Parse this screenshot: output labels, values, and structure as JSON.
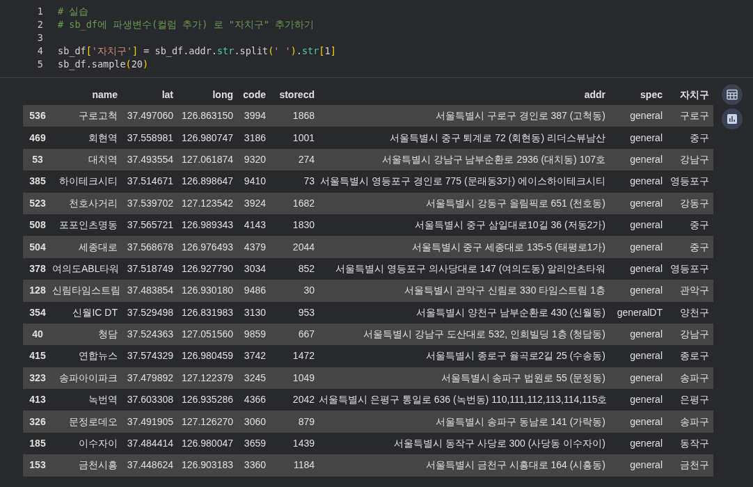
{
  "code": {
    "lines": [
      {
        "number": "1",
        "tokens": [
          {
            "text": "# 실습",
            "kind": "comment"
          }
        ]
      },
      {
        "number": "2",
        "tokens": [
          {
            "text": "# sb_df에 파생변수(컬럼 추가) 로 \"자치구\" 추가하기",
            "kind": "comment"
          }
        ]
      },
      {
        "number": "3"
      },
      {
        "number": "4",
        "tokens": [
          {
            "text": "sb_df",
            "kind": "plain"
          },
          {
            "text": "[",
            "kind": "bracket"
          },
          {
            "text": "'자치구'",
            "kind": "string"
          },
          {
            "text": "]",
            "kind": "bracket"
          },
          {
            "text": " = sb_df.addr.",
            "kind": "plain"
          },
          {
            "text": "str",
            "kind": "builtin"
          },
          {
            "text": ".split",
            "kind": "plain"
          },
          {
            "text": "(",
            "kind": "bracket"
          },
          {
            "text": "' '",
            "kind": "string"
          },
          {
            "text": ")",
            "kind": "bracket"
          },
          {
            "text": ".",
            "kind": "plain"
          },
          {
            "text": "str",
            "kind": "builtin"
          },
          {
            "text": "[",
            "kind": "bracket"
          },
          {
            "text": "1",
            "kind": "plain"
          },
          {
            "text": "]",
            "kind": "bracket"
          }
        ]
      },
      {
        "number": "5",
        "tokens": [
          {
            "text": "sb_df.sample",
            "kind": "plain"
          },
          {
            "text": "(",
            "kind": "bracket"
          },
          {
            "text": "20",
            "kind": "plain"
          },
          {
            "text": ")",
            "kind": "bracket"
          }
        ]
      }
    ]
  },
  "table": {
    "columns": [
      "name",
      "lat",
      "long",
      "code",
      "storecd",
      "addr",
      "spec",
      "자치구"
    ],
    "rows": [
      {
        "index": "536",
        "cells": [
          "구로고척",
          "37.497060",
          "126.863150",
          "3994",
          "1868",
          "서울특별시 구로구 경인로 387 (고척동)",
          "general",
          "구로구"
        ]
      },
      {
        "index": "469",
        "cells": [
          "회현역",
          "37.558981",
          "126.980747",
          "3186",
          "1001",
          "서울특별시 중구 퇴계로 72 (회현동) 리더스뷰남산",
          "general",
          "중구"
        ]
      },
      {
        "index": "53",
        "cells": [
          "대치역",
          "37.493554",
          "127.061874",
          "9320",
          "274",
          "서울특별시 강남구 남부순환로 2936 (대치동) 107호",
          "general",
          "강남구"
        ]
      },
      {
        "index": "385",
        "cells": [
          "하이테크시티",
          "37.514671",
          "126.898647",
          "9410",
          "73",
          "서울특별시 영등포구 경인로 775 (문래동3가) 에이스하이테크시티",
          "general",
          "영등포구"
        ]
      },
      {
        "index": "523",
        "cells": [
          "천호사거리",
          "37.539702",
          "127.123542",
          "3924",
          "1682",
          "서울특별시 강동구 올림픽로 651 (천호동)",
          "general",
          "강동구"
        ]
      },
      {
        "index": "508",
        "cells": [
          "포포인츠명동",
          "37.565721",
          "126.989343",
          "4143",
          "1830",
          "서울특별시 중구 삼일대로10길 36 (저동2가)",
          "general",
          "중구"
        ]
      },
      {
        "index": "504",
        "cells": [
          "세종대로",
          "37.568678",
          "126.976493",
          "4379",
          "2044",
          "서울특별시 중구 세종대로 135-5 (태평로1가)",
          "general",
          "중구"
        ]
      },
      {
        "index": "378",
        "cells": [
          "여의도ABL타워",
          "37.518749",
          "126.927790",
          "3034",
          "852",
          "서울특별시 영등포구 의사당대로 147 (여의도동) 알리안츠타워",
          "general",
          "영등포구"
        ]
      },
      {
        "index": "128",
        "cells": [
          "신림타임스트림",
          "37.483854",
          "126.930180",
          "9486",
          "30",
          "서울특별시 관악구 신림로 330 타임스트림 1층",
          "general",
          "관악구"
        ]
      },
      {
        "index": "354",
        "cells": [
          "신월IC DT",
          "37.529498",
          "126.831983",
          "3130",
          "953",
          "서울특별시 양천구 남부순환로 430 (신월동)",
          "generalDT",
          "양천구"
        ]
      },
      {
        "index": "40",
        "cells": [
          "청담",
          "37.524363",
          "127.051560",
          "9859",
          "667",
          "서울특별시 강남구 도산대로 532, 인희빌딩 1층 (청담동)",
          "general",
          "강남구"
        ]
      },
      {
        "index": "415",
        "cells": [
          "연합뉴스",
          "37.574329",
          "126.980459",
          "3742",
          "1472",
          "서울특별시 종로구 율곡로2길 25 (수송동)",
          "general",
          "종로구"
        ]
      },
      {
        "index": "323",
        "cells": [
          "송파아이파크",
          "37.479892",
          "127.122379",
          "3245",
          "1049",
          "서울특별시 송파구 법원로 55 (문정동)",
          "general",
          "송파구"
        ]
      },
      {
        "index": "413",
        "cells": [
          "녹번역",
          "37.603308",
          "126.935286",
          "4366",
          "2042",
          "서울특별시 은평구 통일로 636 (녹번동) 110,111,112,113,114,115호",
          "general",
          "은평구"
        ]
      },
      {
        "index": "326",
        "cells": [
          "문정로데오",
          "37.491905",
          "127.126270",
          "3060",
          "879",
          "서울특별시 송파구 동남로 141 (가락동)",
          "general",
          "송파구"
        ]
      },
      {
        "index": "185",
        "cells": [
          "이수자이",
          "37.484414",
          "126.980047",
          "3659",
          "1439",
          "서울특별시 동작구 사당로 300 (사당동 이수자이)",
          "general",
          "동작구"
        ]
      },
      {
        "index": "153",
        "cells": [
          "금천시흥",
          "37.448624",
          "126.903183",
          "3360",
          "1184",
          "서울특별시 금천구 시흥대로 164 (시흥동)",
          "general",
          "금천구"
        ]
      }
    ]
  }
}
